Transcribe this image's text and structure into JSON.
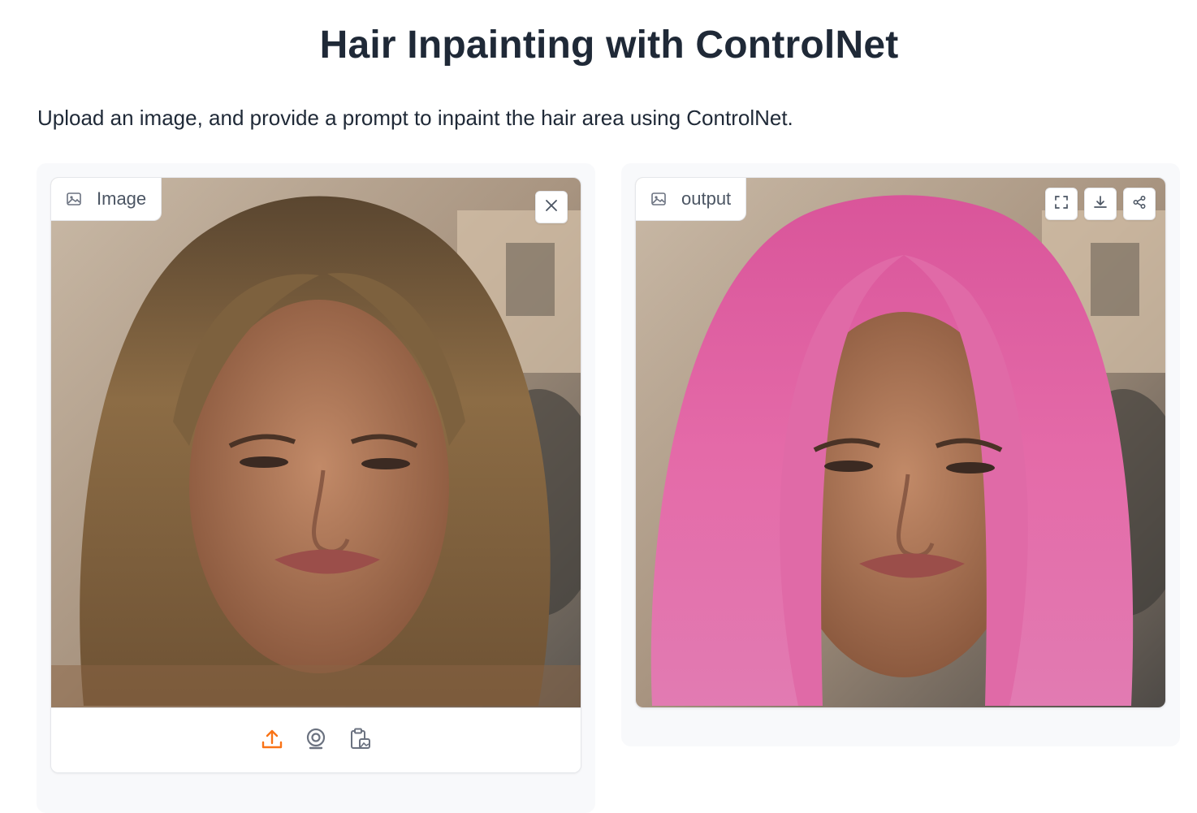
{
  "page": {
    "title": "Hair Inpainting with ControlNet",
    "description": "Upload an image, and provide a prompt to inpaint the hair area using ControlNet."
  },
  "input_image": {
    "label": "Image",
    "label_icon": "image-icon",
    "actions": [
      "close-icon"
    ],
    "sources": [
      {
        "name": "upload-icon",
        "active": true
      },
      {
        "name": "webcam-icon",
        "active": false
      },
      {
        "name": "clipboard-icon",
        "active": false
      }
    ]
  },
  "output_image": {
    "label": "output",
    "label_icon": "image-icon",
    "actions": [
      "fullscreen-icon",
      "download-icon",
      "share-icon"
    ]
  },
  "colors": {
    "accent": "#f97316",
    "icon_gray": "#6b7280",
    "original_hair": "#8a6a3f",
    "output_hair": "#e46aa8"
  }
}
